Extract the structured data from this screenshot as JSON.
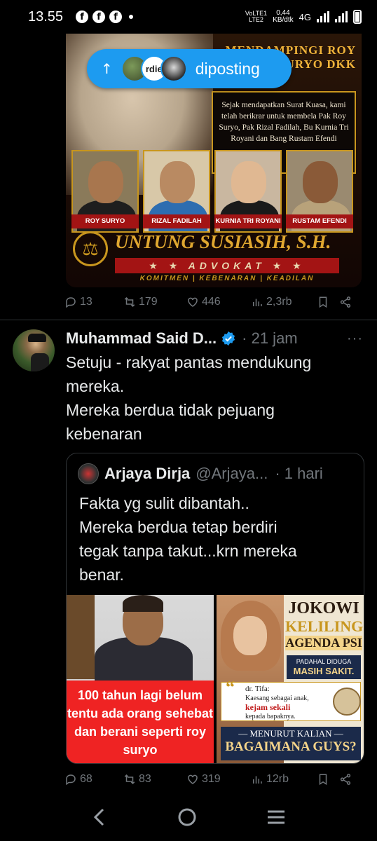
{
  "status_bar": {
    "time": "13.55",
    "net_top": "VoLTE1",
    "net_bottom": "LTE2",
    "speed_value": "0,44",
    "speed_unit": "KB/dtk",
    "network": "4G"
  },
  "posted_pill": {
    "label": "diposting",
    "avatar_text": "rdie"
  },
  "post1_image": {
    "headline": "MENDAMPINGI ROY SURYO DKK",
    "quote_text": "Sejak mendapatkan Surat Kuasa, kami telah berikrar untuk membela Pak Roy Suryo, Pak Rizal Fadilah, Bu Kurnia Tri Royani dan Bang Rustam Efendi",
    "people": [
      "ROY SURYO",
      "RIZAL FADILAH",
      "KURNIA TRI ROYANI",
      "RUSTAM EFENDI"
    ],
    "lawyer": "UNTUNG SUSIASIH, S.H.",
    "title": "★ ★ ADVOKAT ★ ★",
    "motto": "KOMITMEN | KEBENARAN | KEADILAN"
  },
  "post1_actions": {
    "replies": "13",
    "reposts": "179",
    "likes": "446",
    "views": "2,3rb"
  },
  "tweet": {
    "author": "Muhammad Said D...",
    "time": "· 21 jam",
    "more": "···",
    "text_line1": "Setuju - rakyat pantas mendukung",
    "text_line2": "mereka.",
    "text_line3": "Mereka berdua tidak pejuang",
    "text_line4": "kebenaran"
  },
  "quote": {
    "author": "Arjaya Dirja",
    "handle": "@Arjaya...",
    "time": "· 1 hari",
    "text_line1": "Fakta yg sulit dibantah..",
    "text_line2": "Mereka berdua tetap berdiri",
    "text_line3": "tegak tanpa takut...krn mereka",
    "text_line4": "benar.",
    "media_left_caption": "100 tahun lagi belum tentu ada orang sehebat dan berani seperti roy suryo",
    "media_right": {
      "title1": "JOKOWI",
      "title2": "KELILING",
      "title3": "AGENDA PSI",
      "sub1": "PADAHAL DIDUGA",
      "sub2": "MASIH SAKIT.",
      "quote_name": "dr. Tifa:",
      "quote_line1": "Kaesang sebagai anak,",
      "quote_red": "kejam sekali",
      "quote_line2": "kepada bapaknya.",
      "bottom1": "— MENURUT KALIAN —",
      "bottom2": "BAGAIMANA GUYS?"
    }
  },
  "tweet_actions": {
    "replies": "68",
    "reposts": "83",
    "likes": "319",
    "views": "12rb"
  },
  "colors": {
    "background": "#000000",
    "accent": "#1d9bf0",
    "muted": "#71767b",
    "text": "#e7e9ea"
  }
}
